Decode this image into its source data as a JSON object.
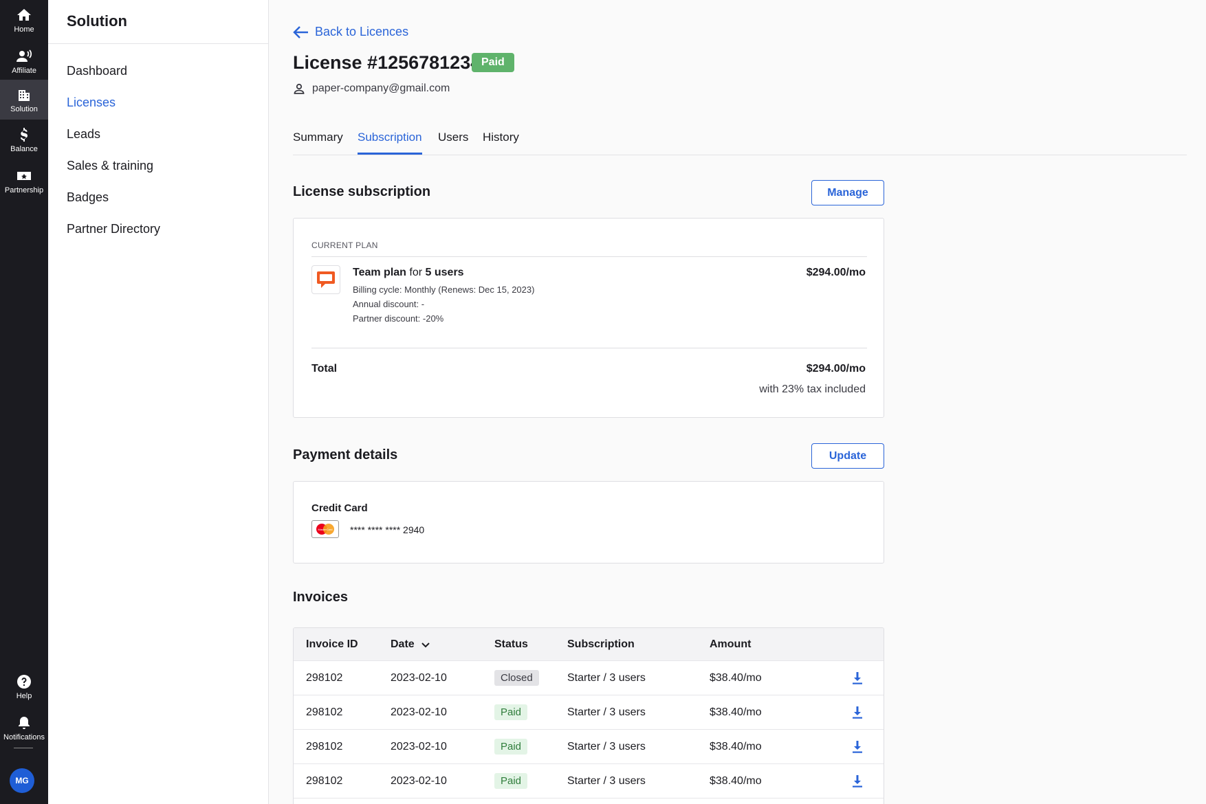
{
  "rail": {
    "items": [
      {
        "label": "Home",
        "icon": "home-icon"
      },
      {
        "label": "Affiliate",
        "icon": "affiliate-icon"
      },
      {
        "label": "Solution",
        "icon": "building-icon"
      },
      {
        "label": "Balance",
        "icon": "dollar-icon"
      },
      {
        "label": "Partnership",
        "icon": "partnership-icon"
      }
    ],
    "help_label": "Help",
    "notifications_label": "Notifications",
    "avatar_initials": "MG",
    "accent": "#2a64d8"
  },
  "subnav": {
    "title": "Solution",
    "items": [
      {
        "label": "Dashboard"
      },
      {
        "label": "Licenses"
      },
      {
        "label": "Leads"
      },
      {
        "label": "Sales & training"
      },
      {
        "label": "Badges"
      },
      {
        "label": "Partner Directory"
      }
    ]
  },
  "header": {
    "back_label": "Back to Licences",
    "title": "License #1256781234",
    "status_badge": "Paid",
    "owner_email": "paper-company@gmail.com"
  },
  "tabs": [
    {
      "label": "Summary"
    },
    {
      "label": "Subscription"
    },
    {
      "label": "Users"
    },
    {
      "label": "History"
    }
  ],
  "subscription": {
    "title": "License subscription",
    "manage_label": "Manage",
    "current_plan_label": "CURRENT PLAN",
    "plan_name": "Team plan",
    "plan_for": "for",
    "plan_users": "5 users",
    "billing_cycle": "Billing cycle: Monthly (Renews: Dec 15, 2023)",
    "annual_discount": "Annual discount: -",
    "partner_discount": "Partner discount: -20%",
    "plan_price": "$294.00/mo",
    "total_label": "Total",
    "total_price": "$294.00/mo",
    "tax_note": "with 23% tax included"
  },
  "payment": {
    "title": "Payment details",
    "update_label": "Update",
    "method_label": "Credit Card",
    "card_number": "**** **** **** 2940",
    "card_brand_text": "MasterCard"
  },
  "invoices": {
    "title": "Invoices",
    "columns": [
      "Invoice ID",
      "Date",
      "Status",
      "Subscription",
      "Amount"
    ],
    "rows": [
      {
        "id": "298102",
        "date": "2023-02-10",
        "status": "Closed",
        "subscription": "Starter / 3 users",
        "amount": "$38.40/mo"
      },
      {
        "id": "298102",
        "date": "2023-02-10",
        "status": "Paid",
        "subscription": "Starter / 3 users",
        "amount": "$38.40/mo"
      },
      {
        "id": "298102",
        "date": "2023-02-10",
        "status": "Paid",
        "subscription": "Starter / 3 users",
        "amount": "$38.40/mo"
      },
      {
        "id": "298102",
        "date": "2023-02-10",
        "status": "Paid",
        "subscription": "Starter / 3 users",
        "amount": "$38.40/mo"
      }
    ]
  }
}
